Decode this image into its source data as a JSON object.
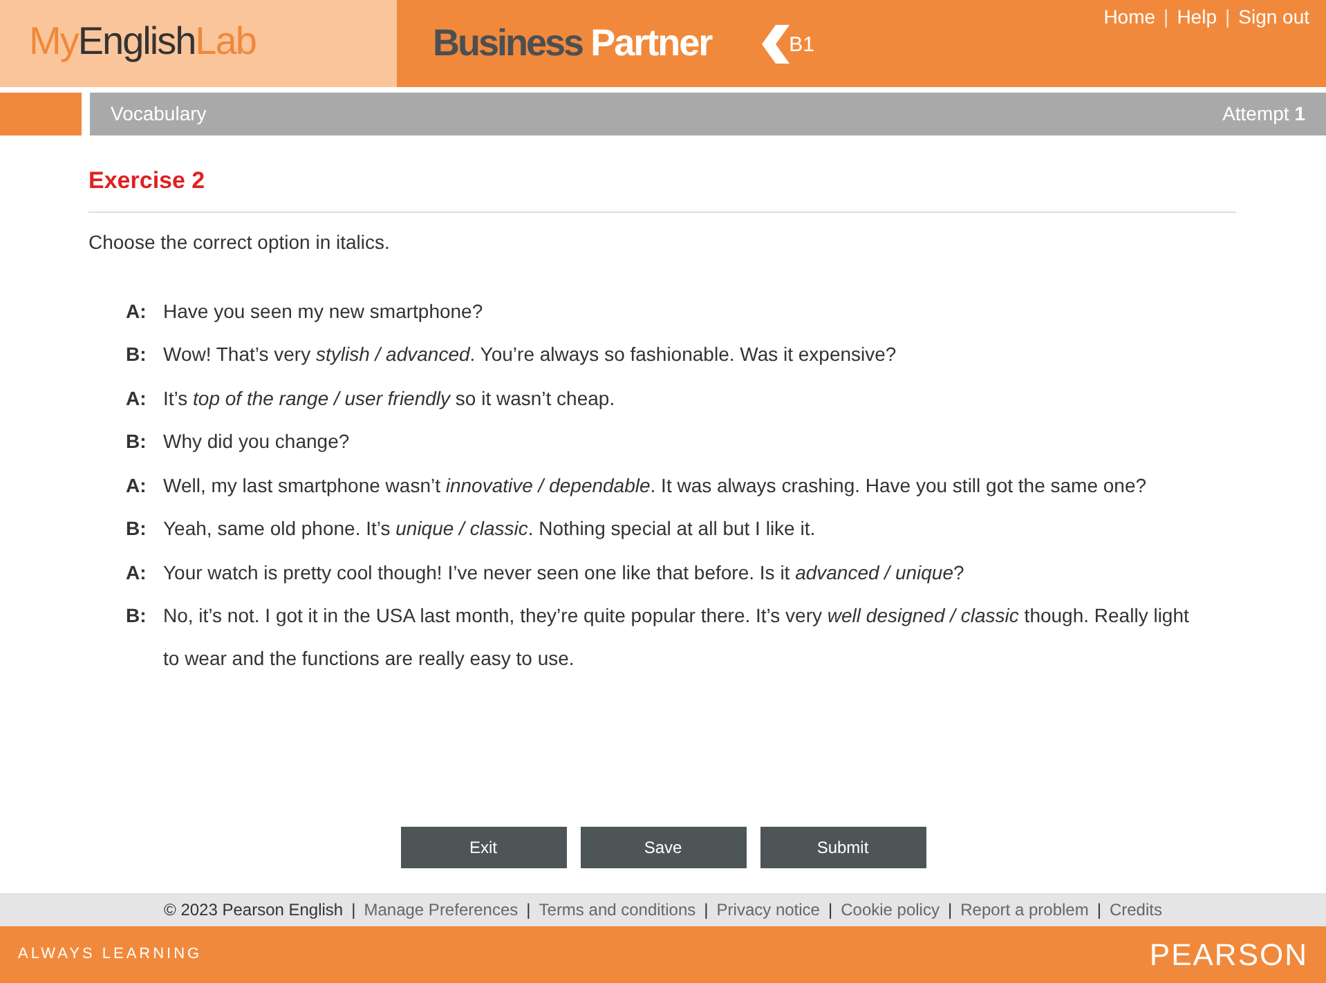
{
  "header": {
    "logo": [
      {
        "text": "My",
        "kind": "accent"
      },
      {
        "text": "English",
        "kind": "plain"
      },
      {
        "text": "Lab",
        "kind": "accent"
      }
    ],
    "brand": {
      "first": "Business",
      "second": "Partner"
    },
    "level": "B1",
    "nav": [
      {
        "kind": "link",
        "text": "Home"
      },
      {
        "kind": "separator",
        "text": "|"
      },
      {
        "kind": "link",
        "text": "Help"
      },
      {
        "kind": "separator",
        "text": "|"
      },
      {
        "kind": "link",
        "text": "Sign out"
      }
    ]
  },
  "section_bar": {
    "title": "Vocabulary",
    "attempt_label": "Attempt",
    "attempt_number": "1"
  },
  "exercise": {
    "title": "Exercise 2",
    "instruction": "Choose the correct option in italics.",
    "lines": [
      {
        "speaker": "A:",
        "text": "Have you seen my new smartphone?"
      },
      {
        "speaker": "B:",
        "text": "Wow! That’s very *stylish / advanced*. You’re always so fashionable. Was it expensive?"
      },
      {
        "speaker": "A:",
        "text": "It’s *top of the range / user friendly* so it wasn’t cheap."
      },
      {
        "speaker": "B:",
        "text": "Why did you change?"
      },
      {
        "speaker": "A:",
        "text": "Well, my last smartphone wasn’t *innovative / dependable*. It was always crashing. Have you still got the same one?"
      },
      {
        "speaker": "B:",
        "text": "Yeah, same old phone. It’s *unique / classic*. Nothing special at all but I like it."
      },
      {
        "speaker": "A:",
        "text": "Your watch is pretty cool though! I’ve never seen one like that before. Is it *advanced / unique*?"
      },
      {
        "speaker": "B:",
        "text": "No, it’s not. I got it in the USA last month, they’re quite popular there. It’s very *well designed / classic* though. Really light to wear and the functions are really easy to use."
      }
    ]
  },
  "buttons": [
    "Exit",
    "Save",
    "Submit"
  ],
  "footer": {
    "items": [
      {
        "kind": "text",
        "text": "© 2023 Pearson English"
      },
      {
        "kind": "separator",
        "text": "|"
      },
      {
        "kind": "link",
        "text": "Manage Preferences"
      },
      {
        "kind": "separator",
        "text": "|"
      },
      {
        "kind": "link",
        "text": "Terms and conditions"
      },
      {
        "kind": "separator",
        "text": "|"
      },
      {
        "kind": "link",
        "text": "Privacy notice"
      },
      {
        "kind": "separator",
        "text": "|"
      },
      {
        "kind": "link",
        "text": "Cookie policy"
      },
      {
        "kind": "separator",
        "text": "|"
      },
      {
        "kind": "link",
        "text": "Report a problem"
      },
      {
        "kind": "separator",
        "text": "|"
      },
      {
        "kind": "link",
        "text": "Credits"
      }
    ],
    "tagline": "ALWAYS LEARNING",
    "company": "PEARSON"
  }
}
